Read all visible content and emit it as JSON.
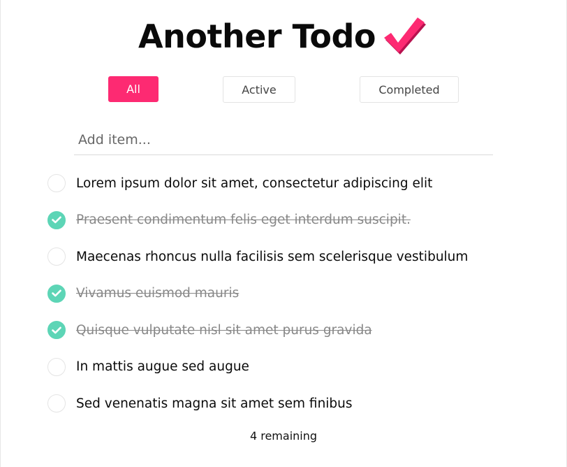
{
  "header": {
    "title": "Another Todo",
    "logo_icon": "checkmark-icon",
    "accent_color": "#fd2a72"
  },
  "filters": {
    "all_label": "All",
    "active_label": "Active",
    "completed_label": "Completed",
    "selected": "All"
  },
  "add_item": {
    "placeholder": "Add item...",
    "value": ""
  },
  "todos": [
    {
      "text": "Lorem ipsum dolor sit amet, consectetur adipiscing elit",
      "completed": false
    },
    {
      "text": "Praesent condimentum felis eget interdum suscipit.",
      "completed": true
    },
    {
      "text": "Maecenas rhoncus nulla facilisis sem scelerisque vestibulum",
      "completed": false
    },
    {
      "text": "Vivamus euismod mauris",
      "completed": true
    },
    {
      "text": "Quisque vulputate nisl sit amet purus gravida",
      "completed": true
    },
    {
      "text": "In mattis augue sed augue",
      "completed": false
    },
    {
      "text": "Sed venenatis magna sit amet sem finibus",
      "completed": false
    }
  ],
  "footer": {
    "remaining_text": "4 remaining"
  },
  "colors": {
    "check_done": "#5dd5b6",
    "completed_text": "#888888"
  }
}
